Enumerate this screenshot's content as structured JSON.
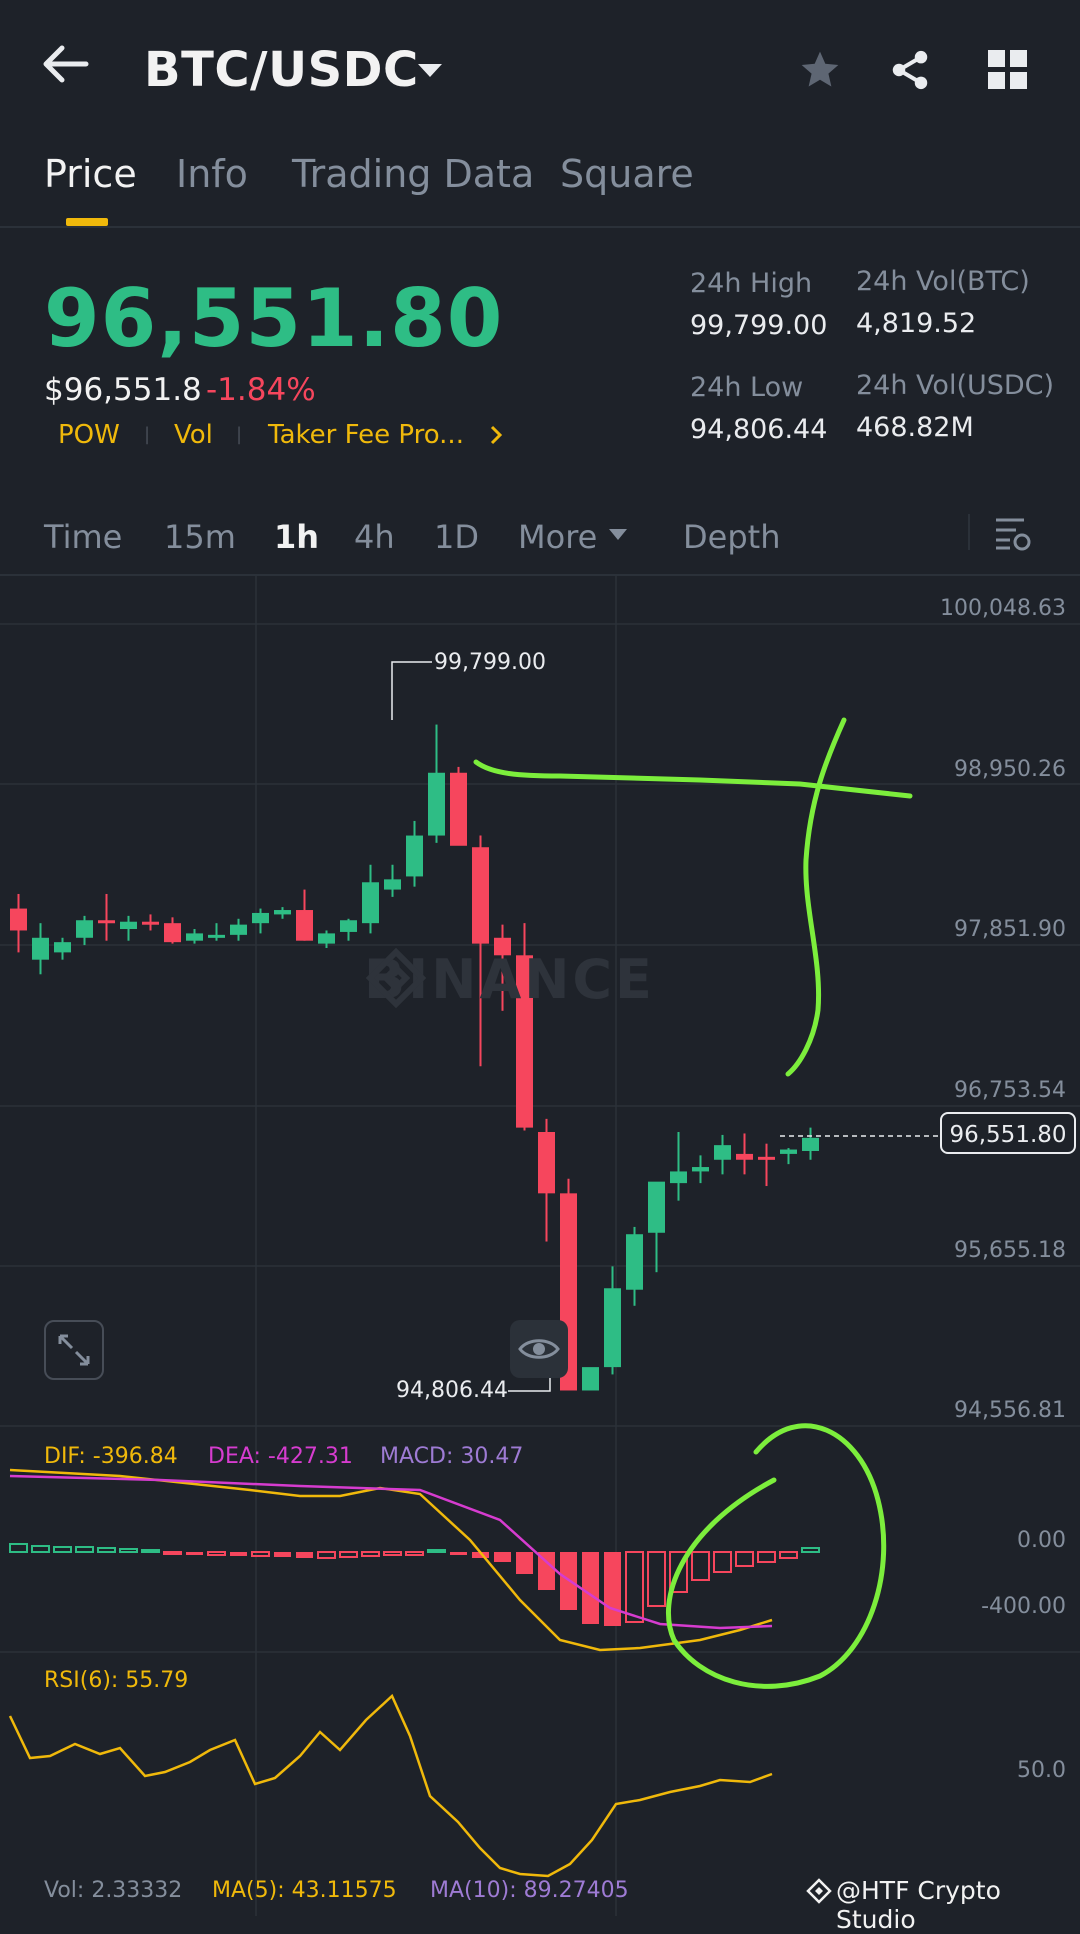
{
  "header": {
    "pair": "BTC/USDC",
    "icons": [
      "back-arrow-icon",
      "chevron-down-icon",
      "star-icon",
      "share-icon",
      "grid-icon"
    ]
  },
  "tabs": [
    {
      "label": "Price",
      "active": true
    },
    {
      "label": "Info",
      "active": false
    },
    {
      "label": "Trading Data",
      "active": false
    },
    {
      "label": "Square",
      "active": false
    }
  ],
  "price": {
    "last": "96,551.80",
    "usd": "$96,551.8",
    "change": "-1.84%",
    "up_color": "#2ebd85",
    "down_color": "#f6465d"
  },
  "tags": [
    "POW",
    "Vol",
    "Taker Fee Pro..."
  ],
  "stats": {
    "high_label": "24h High",
    "high_value": "99,799.00",
    "low_label": "24h Low",
    "low_value": "94,806.44",
    "vol_btc_label": "24h Vol(BTC)",
    "vol_btc_value": "4,819.52",
    "vol_usdc_label": "24h Vol(USDC)",
    "vol_usdc_value": "468.82M"
  },
  "intervals": [
    {
      "label": "Time",
      "active": false
    },
    {
      "label": "15m",
      "active": false
    },
    {
      "label": "1h",
      "active": true
    },
    {
      "label": "4h",
      "active": false
    },
    {
      "label": "1D",
      "active": false
    },
    {
      "label": "More",
      "active": false
    },
    {
      "label": "Depth",
      "active": false
    }
  ],
  "chart": {
    "watermark": "BINANCE",
    "price_axis": [
      "100,048.63",
      "98,950.26",
      "97,851.90",
      "96,753.54",
      "95,655.18",
      "94,556.81"
    ],
    "high_marker": "99,799.00",
    "low_marker": "94,806.44",
    "current_price": "96,551.80"
  },
  "macd": {
    "dif": "DIF: -396.84",
    "dea": "DEA: -427.31",
    "macd": "MACD: 30.47",
    "axis": [
      "0.00",
      "-400.00"
    ]
  },
  "rsi": {
    "label": "RSI(6): 55.79",
    "axis": [
      "50.0"
    ]
  },
  "volume": {
    "vol": "Vol: 2.33332",
    "ma5": "MA(5): 43.11575",
    "ma10": "MA(10): 89.27405"
  },
  "credit": "@HTF Crypto Studio",
  "chart_data": {
    "type": "candlestick",
    "interval": "1h",
    "y_axis_ticks": [
      100048.63,
      98950.26,
      97851.9,
      96753.54,
      95655.18,
      94556.81
    ],
    "ylim": [
      94556.81,
      100048.63
    ],
    "candles": [
      [
        98100,
        98200,
        97800,
        97950
      ],
      [
        97750,
        98000,
        97650,
        97900
      ],
      [
        97800,
        97900,
        97750,
        97870
      ],
      [
        97900,
        98050,
        97850,
        98020
      ],
      [
        98020,
        98200,
        97880,
        98000
      ],
      [
        97960,
        98050,
        97880,
        98010
      ],
      [
        98010,
        98060,
        97950,
        97990
      ],
      [
        98000,
        98040,
        97860,
        97870
      ],
      [
        97880,
        97960,
        97860,
        97930
      ],
      [
        97900,
        98000,
        97880,
        97920
      ],
      [
        97920,
        98030,
        97880,
        97990
      ],
      [
        98000,
        98100,
        97930,
        98070
      ],
      [
        98060,
        98110,
        98030,
        98090
      ],
      [
        98090,
        98230,
        97880,
        97880
      ],
      [
        97860,
        97950,
        97830,
        97930
      ],
      [
        97940,
        98030,
        97880,
        98020
      ],
      [
        98000,
        98400,
        97930,
        98280
      ],
      [
        98230,
        98400,
        98180,
        98300
      ],
      [
        98320,
        98700,
        98250,
        98600
      ],
      [
        98600,
        99360,
        98550,
        99030
      ],
      [
        99030,
        99070,
        98590,
        98530
      ],
      [
        98520,
        98600,
        97020,
        97860
      ],
      [
        97900,
        97990,
        97400,
        97780
      ],
      [
        97780,
        98000,
        96580,
        96600
      ],
      [
        96570,
        96660,
        95820,
        96150
      ],
      [
        96150,
        96250,
        94840,
        94800
      ],
      [
        94800,
        94900,
        94806.44,
        94960
      ],
      [
        94960,
        95650,
        94910,
        95500
      ],
      [
        95490,
        95920,
        95380,
        95870
      ],
      [
        95880,
        96180,
        95610,
        96230
      ],
      [
        96220,
        96570,
        96100,
        96300
      ],
      [
        96300,
        96410,
        96220,
        96330
      ],
      [
        96380,
        96550,
        96280,
        96480
      ],
      [
        96420,
        96560,
        96280,
        96380
      ],
      [
        96400,
        96490,
        96200,
        96380
      ],
      [
        96420,
        96460,
        96350,
        96450
      ],
      [
        96440,
        96600,
        96380,
        96530
      ]
    ]
  }
}
